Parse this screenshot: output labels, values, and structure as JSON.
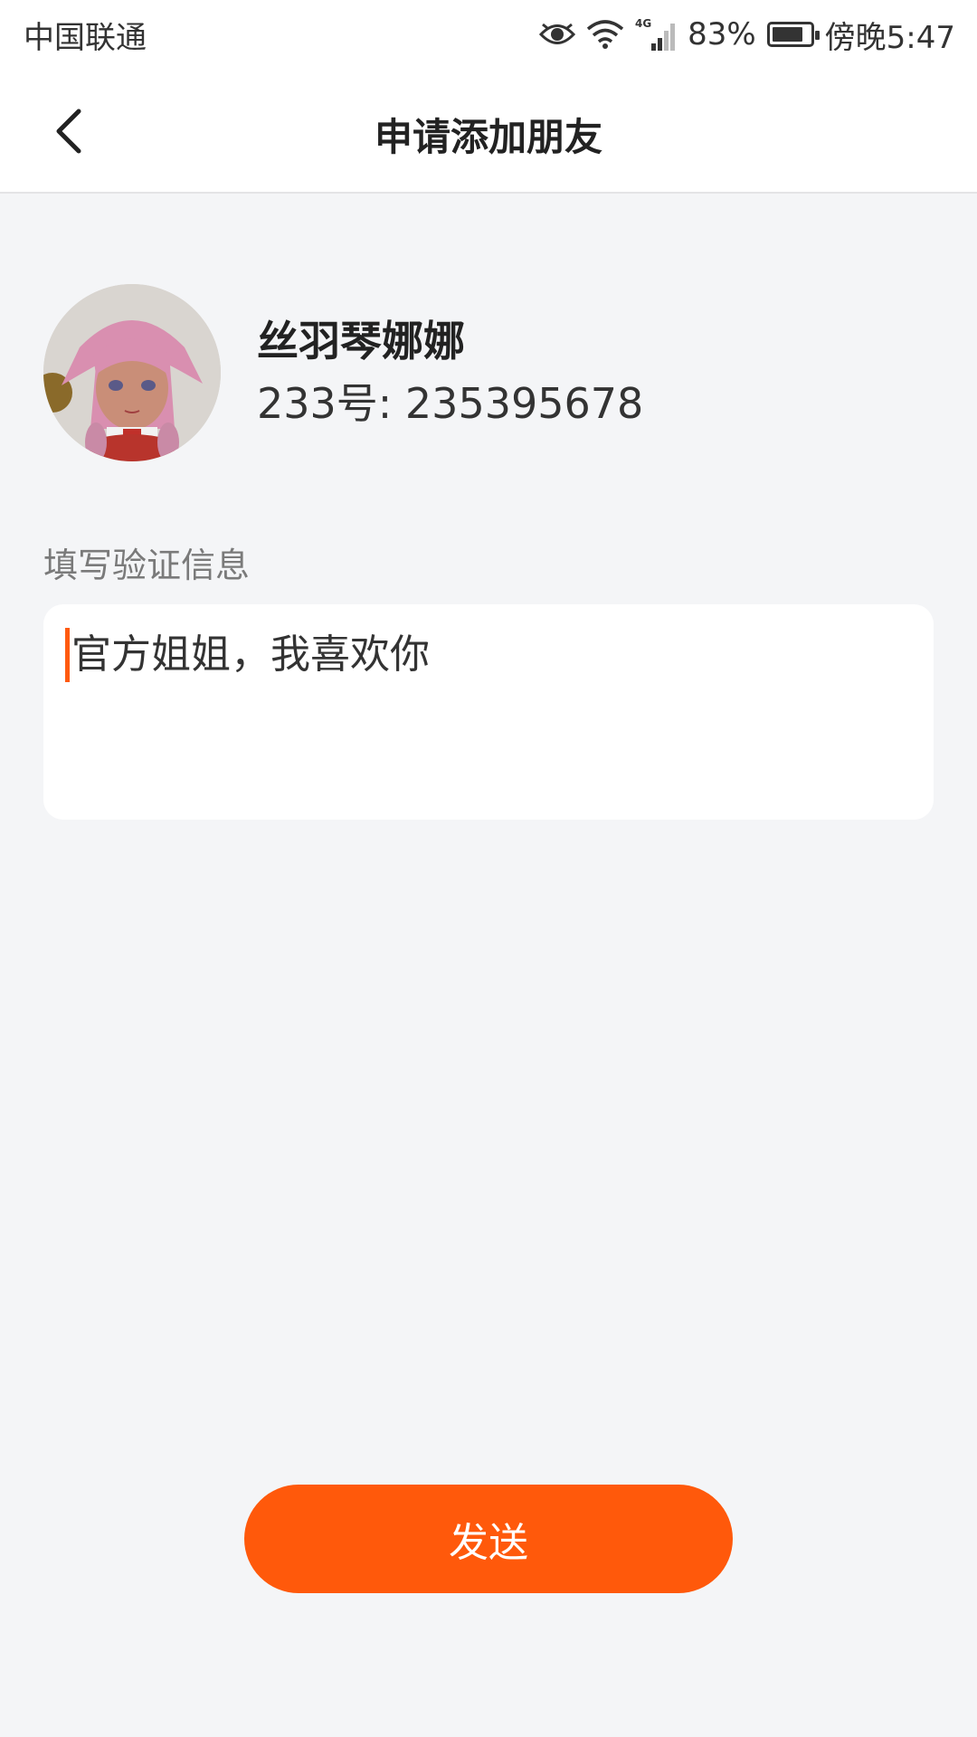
{
  "status_bar": {
    "carrier": "中国联通",
    "network": "4G",
    "battery_percent": "83%",
    "battery_level": 0.83,
    "time": "傍晚5:47",
    "icons": [
      "eye-icon",
      "wifi-icon",
      "signal-icon",
      "battery-icon"
    ]
  },
  "header": {
    "title": "申请添加朋友",
    "back_icon": "chevron-left-icon"
  },
  "profile": {
    "name": "丝羽琴娜娜",
    "id_text": "233号: 235395678"
  },
  "verification": {
    "label": "填写验证信息",
    "message": "官方姐姐，我喜欢你"
  },
  "actions": {
    "send_label": "发送"
  },
  "colors": {
    "accent": "#ff590b",
    "background": "#f4f5f7"
  }
}
